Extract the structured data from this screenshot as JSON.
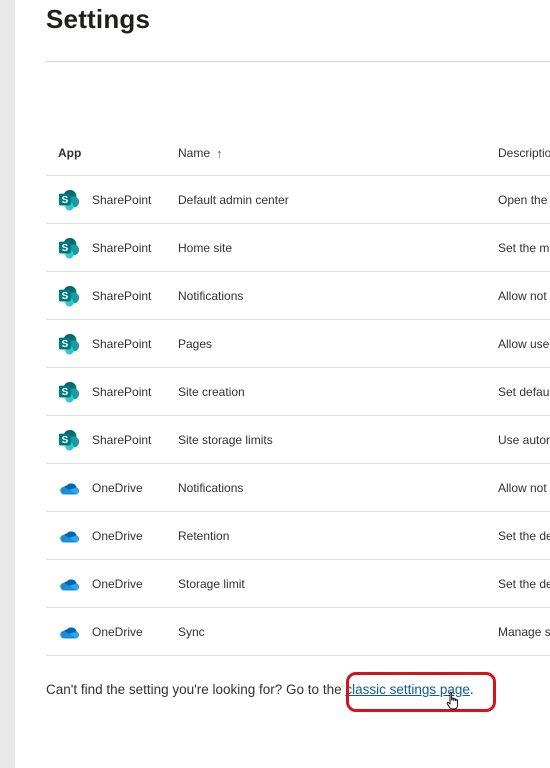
{
  "page": {
    "title": "Settings"
  },
  "table": {
    "columns": {
      "app": "App",
      "name": "Name",
      "description": "Descriptio",
      "sort_indicator": "↑"
    },
    "rows": [
      {
        "app": "SharePoint",
        "icon": "sharepoint-icon",
        "name": "Default admin center",
        "description": "Open the"
      },
      {
        "app": "SharePoint",
        "icon": "sharepoint-icon",
        "name": "Home site",
        "description": "Set the m"
      },
      {
        "app": "SharePoint",
        "icon": "sharepoint-icon",
        "name": "Notifications",
        "description": "Allow not"
      },
      {
        "app": "SharePoint",
        "icon": "sharepoint-icon",
        "name": "Pages",
        "description": "Allow use"
      },
      {
        "app": "SharePoint",
        "icon": "sharepoint-icon",
        "name": "Site creation",
        "description": "Set defaul"
      },
      {
        "app": "SharePoint",
        "icon": "sharepoint-icon",
        "name": "Site storage limits",
        "description": "Use autor"
      },
      {
        "app": "OneDrive",
        "icon": "onedrive-icon",
        "name": "Notifications",
        "description": "Allow not"
      },
      {
        "app": "OneDrive",
        "icon": "onedrive-icon",
        "name": "Retention",
        "description": "Set the de"
      },
      {
        "app": "OneDrive",
        "icon": "onedrive-icon",
        "name": "Storage limit",
        "description": "Set the de"
      },
      {
        "app": "OneDrive",
        "icon": "onedrive-icon",
        "name": "Sync",
        "description": "Manage s"
      }
    ]
  },
  "footer": {
    "prefix": "Can't find the setting you're looking for? Go to the ",
    "link": "classic settings page",
    "suffix": "."
  },
  "colors": {
    "sharepoint": "#038387",
    "onedrive": "#0f78d4",
    "link": "#0f5a9c",
    "highlight": "#d4131b"
  }
}
